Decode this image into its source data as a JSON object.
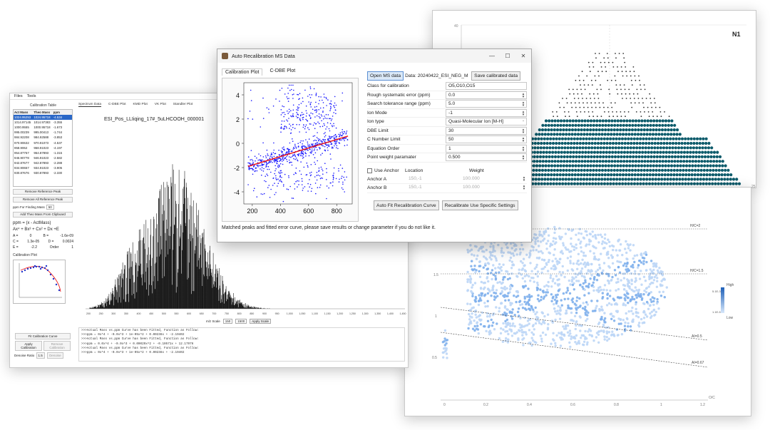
{
  "main_window": {
    "menu": [
      "Files",
      "Tools"
    ],
    "calibration_table": {
      "title": "Calibration Table",
      "headers": [
        "Act Mass",
        "Theo Mass",
        "ppm"
      ],
      "rows": [
        [
          "1024.95253",
          "1024.95718",
          "-4.534"
        ],
        [
          "1014.97145",
          "1014.97383",
          "-3.355"
        ],
        [
          "1000.9555",
          "1000.95718",
          "-1.673"
        ],
        [
          "995.00239",
          "995.00413",
          "-1.744"
        ],
        [
          "984.92208",
          "984.92588",
          "-3.853"
        ],
        [
          "970.90632",
          "970.91073",
          "-4.537"
        ],
        [
          "958.9062",
          "958.91023",
          "-4.197"
        ],
        [
          "954.87767",
          "954.87893",
          "-1.315"
        ],
        [
          "946.90778",
          "946.91023",
          "-2.582"
        ],
        [
          "942.87677",
          "942.87893",
          "-2.288"
        ],
        [
          "934.90657",
          "934.91023",
          "-3.905"
        ],
        [
          "930.87676",
          "930.87893",
          "-2.330"
        ]
      ]
    },
    "buttons": {
      "remove_ref": "Remove Reference Peak",
      "remove_all_ref": "Remove All Reference Peak",
      "ppm_label": "ppm For Finding Mass",
      "ppm_value": "50",
      "add_theo": "Add Theo Mass From Clipboard",
      "fit_curve": "Fit Calibration Curve",
      "apply_cal": "Apply Calibration",
      "remove_cal": "Remove Calibration",
      "denoise_label": "Denoise Ratio",
      "denoise_value": "1.5",
      "denoise_btn": "Denoise"
    },
    "formula": {
      "line1": "ppm = (x - ActMass)",
      "line2": "Ax⁴ + Bx³ + Cx² + Dx +E",
      "coefs": [
        [
          "A =",
          "0",
          "B =",
          "-1.6e-09"
        ],
        [
          "C =",
          "1.3e-05",
          "D =",
          "0.0024"
        ],
        [
          "E =",
          "-2.2",
          "Order",
          "1"
        ]
      ]
    },
    "calibration_plot_title": "Calibration Plot",
    "tabs": [
      "Spectrum Data",
      "C-DBE Plot",
      "KMD Plot",
      "VK Plot",
      "Standler Plot"
    ],
    "spectrum_title": "ESI_Pos_LLIiqing_17#_5uLHCOOH_000001",
    "x_ticks": [
      "200",
      "250",
      "300",
      "350",
      "400",
      "450",
      "500",
      "550",
      "600",
      "650",
      "700",
      "750",
      "800",
      "850",
      "900",
      "950",
      "1,000",
      "1,050",
      "1,100",
      "1,150",
      "1,200",
      "1,250",
      "1,300",
      "1,350",
      "1,400",
      "1,450"
    ],
    "scale": {
      "label": "m/z Scale",
      "from": "150",
      "to": "1500",
      "btn": "Apply Scale"
    },
    "log_lines": [
      ">>>Actual Mass vs.ppm Curve has been Fitted, Function as Follow:",
      ">>>ppm = 0x^4 + -0.0x^3 + 1e-05x^2 + 0.00238x + -2.19402",
      ">>>Actual Mass vs.ppm Curve has been Fitted, Function as Follow:",
      ">>>ppm = 0.0x^4 + -0.0x^3 + 0.00029x^2 + -0.10571x + 12.17976",
      ">>>Actual Mass vs.ppm Curve has been Fitted, Function as Follow:",
      ">>>ppm = 0x^4 + -0.0x^3 + 1e-05x^2 + 0.00238x + -2.19402"
    ]
  },
  "n1_plot": {
    "title": "N1",
    "y_tick_top": "40",
    "y_tick_right": "25"
  },
  "vk_plot": {
    "lines": [
      "H/C=2",
      "H/C=1.5",
      "AI=0.5",
      "AI=0.67"
    ],
    "x_ticks": [
      "0",
      "0.2",
      "0.4",
      "0.6",
      "0.8",
      "1",
      "1.2"
    ],
    "x_label": "O/C",
    "y_ticks": [
      "0.5",
      "1",
      "1.5"
    ],
    "legend": {
      "high": "High",
      "low": "Low",
      "val_top": "5.1E-3",
      "val_bottom": "1.1E-5"
    }
  },
  "dialog": {
    "title": "Auto Recalibration MS Data",
    "window_controls": [
      "—",
      "☐",
      "✕"
    ],
    "tabs": [
      "Calibration Plot",
      "C-DBE Plot"
    ],
    "open_btn": "Open MS data",
    "data_label": "Data: 20240422_ESI_NEG_M",
    "save_btn": "Save calibrated data",
    "fields": [
      {
        "label": "Class for calibration",
        "value": "O5,O10,O15"
      },
      {
        "label": "Rough systematic error (ppm)",
        "value": "0.0"
      },
      {
        "label": "Search tolerance range (ppm)",
        "value": "5.0"
      },
      {
        "label": "Ion Mode",
        "value": "-1"
      },
      {
        "label": "Ion type",
        "value": "Quasi-Molecular Ion [M-H]"
      },
      {
        "label": "DBE Limit",
        "value": "30"
      },
      {
        "label": "C Number Limit",
        "value": "50"
      },
      {
        "label": "Equation Order",
        "value": "1"
      },
      {
        "label": "Point weight paramater",
        "value": "0.500"
      }
    ],
    "anchor": {
      "use_label": "Use Anchor",
      "col_location": "Location",
      "col_weight": "Weight",
      "a_label": "Anchor A",
      "a_loc": "150,-1",
      "a_weight": "100.000",
      "b_label": "Anchor B",
      "b_loc": "150,-1",
      "b_weight": "100.000"
    },
    "auto_fit_btn": "Auto Fit Recalibration Curve",
    "recal_btn": "Recalibrate Use Specific Settings",
    "footer": "Matched peaks and fitted error curve, please save results or change parameter if you do not like it.",
    "plot": {
      "x_ticks": [
        "200",
        "400",
        "600",
        "800"
      ],
      "y_ticks": [
        "4",
        "2",
        "0",
        "-2",
        "-4"
      ],
      "fit_line": {
        "x": [
          170,
          880
        ],
        "y": [
          -1.9,
          0.6
        ]
      },
      "point_color": "#1a1aff",
      "line_color": "#ee1111"
    }
  }
}
